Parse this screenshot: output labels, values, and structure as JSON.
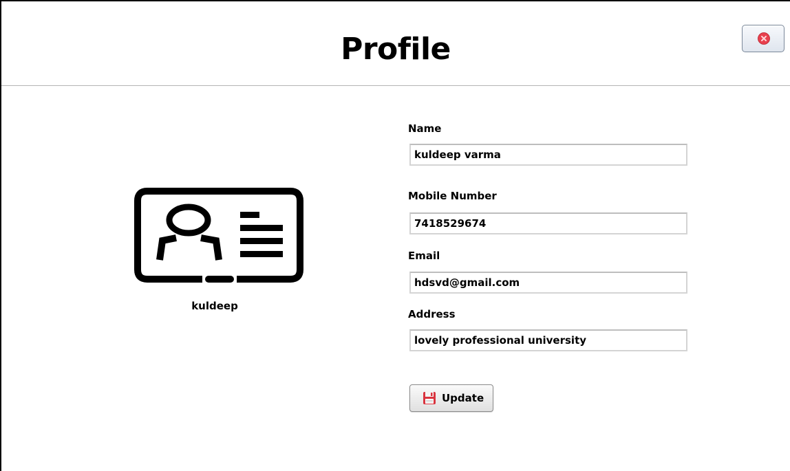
{
  "header": {
    "title": "Profile",
    "close_icon": "close-icon"
  },
  "profile": {
    "avatar_icon": "id-card-icon",
    "username": "kuldeep"
  },
  "form": {
    "name": {
      "label": "Name",
      "value": "kuldeep varma"
    },
    "mobile": {
      "label": "Mobile Number",
      "value": "7418529674"
    },
    "email": {
      "label": "Email",
      "value": "hdsvd@gmail.com"
    },
    "address": {
      "label": "Address",
      "value": "lovely professional university"
    }
  },
  "actions": {
    "update_label": "Update",
    "update_icon": "save-icon"
  },
  "colors": {
    "close_red": "#e8404e",
    "save_red": "#d9343f"
  }
}
